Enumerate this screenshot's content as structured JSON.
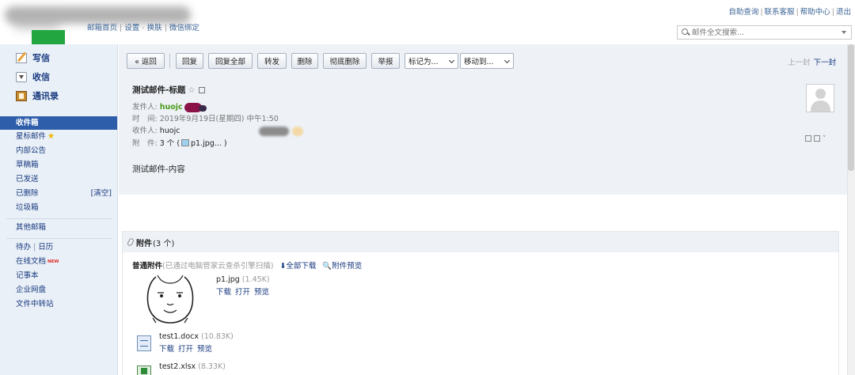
{
  "header": {
    "nav": [
      "邮箱首页",
      "设置",
      "换肤",
      "微信绑定"
    ],
    "top_links": [
      "自助查询",
      "联系客服",
      "帮助中心",
      "退出"
    ],
    "search_placeholder": "邮件全文搜索..."
  },
  "sidebar": {
    "compose": "写信",
    "inbox": "收信",
    "contacts": "通讯录",
    "folders": {
      "inbox": "收件箱",
      "starred": "星标邮件",
      "internal": "内部公告",
      "drafts": "草稿箱",
      "sent": "已发送",
      "deleted": "已删除",
      "deleted_clear": "[清空]",
      "spam": "垃圾箱",
      "other": "其他邮箱"
    },
    "tools": {
      "todo": "待办",
      "sep": "|",
      "calendar": "日历",
      "online_doc": "在线文档",
      "new_badge": "NEW",
      "notes": "记事本",
      "netdisk": "企业网盘",
      "file_transfer": "文件中转站"
    }
  },
  "toolbar": {
    "back": "« 返回",
    "reply": "回复",
    "reply_all": "回复全部",
    "forward": "转发",
    "delete": "删除",
    "delete_forever": "彻底删除",
    "report": "举报",
    "mark_as": "标记为...",
    "move_to": "移动到...",
    "prev": "上一封",
    "next": "下一封"
  },
  "mail": {
    "subject": "测试邮件-标题",
    "from_label": "发件人:",
    "from_value": "huojc",
    "time_label": "时　间:",
    "time_value": "2019年9月19日(星期四) 中午1:50",
    "to_label": "收件人:",
    "to_value": "huojc",
    "attach_label": "附　件:",
    "attach_count": "3 个 (",
    "attach_preview": "p1.jpg... )",
    "body": "测试邮件-内容"
  },
  "attachments": {
    "title": "附件",
    "count": "(3 个)",
    "normal_label": "普通附件",
    "scan_note": "(已通过电脑管家云查杀引擎扫描)",
    "download_all": "全部下载",
    "preview_all": "附件预览",
    "files": [
      {
        "name": "p1.jpg",
        "size": "(1.45K)",
        "actions": [
          "下载",
          "打开",
          "预览"
        ]
      },
      {
        "name": "test1.docx",
        "size": "(10.83K)",
        "actions": [
          "下载",
          "打开",
          "预览"
        ]
      },
      {
        "name": "test2.xlsx",
        "size": "(8.33K)",
        "actions": []
      }
    ]
  },
  "colors": {
    "sidebar_active": "#2e5eaa",
    "link": "#16387e",
    "sender": "#4a9a1a"
  }
}
